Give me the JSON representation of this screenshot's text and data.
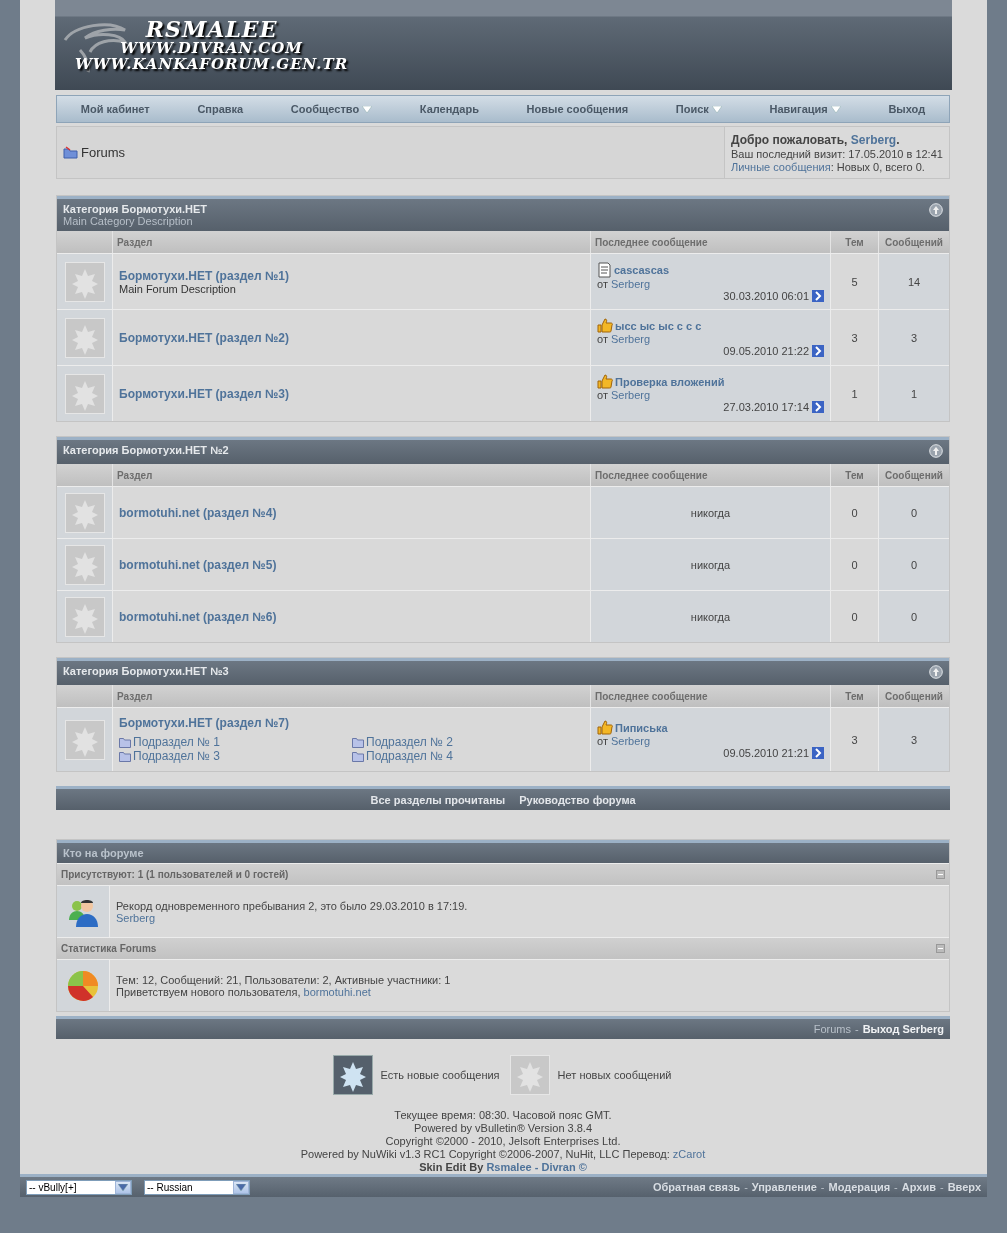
{
  "header": {
    "logo_lines": [
      "RSMALEE",
      "WWW.DIVRAN.COM",
      "WWW.KANKAFORUM.GEN.TR"
    ]
  },
  "navbar": [
    {
      "label": "Мой кабинет",
      "dropdown": false
    },
    {
      "label": "Справка",
      "dropdown": false
    },
    {
      "label": "Сообщество",
      "dropdown": true
    },
    {
      "label": "Календарь",
      "dropdown": false
    },
    {
      "label": "Новые сообщения",
      "dropdown": false
    },
    {
      "label": "Поиск",
      "dropdown": true
    },
    {
      "label": "Навигация",
      "dropdown": true
    },
    {
      "label": "Выход",
      "dropdown": false
    }
  ],
  "breadcrumb": {
    "title": "Forums"
  },
  "welcome": {
    "greeting": "Добро пожаловать, ",
    "user": "Serberg",
    "end": ".",
    "last_visit": "Ваш последний визит: 17.05.2010 в 12:41",
    "pm_link": "Личные сообщения",
    "pm_text": ": Новых 0, всего 0."
  },
  "categories": [
    {
      "title": "Категория Бормотухи.НЕТ",
      "description": "Main Category Description",
      "columns": [
        "Раздел",
        "Последнее сообщение",
        "Тем",
        "Сообщений"
      ],
      "forums": [
        {
          "title": "Бормотухи.НЕТ (раздел №1)",
          "description": "Main Forum Description",
          "new_posts": false,
          "last_post": {
            "kind": "document",
            "title": "cascascas",
            "by": "от",
            "user": "Serberg",
            "date": "30.03.2010 06:01"
          },
          "threads": "5",
          "posts": "14"
        },
        {
          "title": "Бормотухи.НЕТ (раздел №2)",
          "new_posts": false,
          "last_post": {
            "kind": "thumb",
            "title": "ысс ыс ыс с с с",
            "by": "от",
            "user": "Serberg",
            "date": "09.05.2010 21:22"
          },
          "threads": "3",
          "posts": "3"
        },
        {
          "title": "Бормотухи.НЕТ (раздел №3)",
          "new_posts": false,
          "last_post": {
            "kind": "thumb",
            "title": "Проверка вложений",
            "by": "от",
            "user": "Serberg",
            "date": "27.03.2010 17:14"
          },
          "threads": "1",
          "posts": "1"
        }
      ]
    },
    {
      "title": "Категория Бормотухи.НЕТ №2",
      "columns": [
        "Раздел",
        "Последнее сообщение",
        "Тем",
        "Сообщений"
      ],
      "forums": [
        {
          "title": "bormotuhi.net (раздел №4)",
          "new_posts": false,
          "last_post": {
            "kind": "never",
            "text": "никогда"
          },
          "threads": "0",
          "posts": "0"
        },
        {
          "title": "bormotuhi.net (раздел №5)",
          "new_posts": false,
          "last_post": {
            "kind": "never",
            "text": "никогда"
          },
          "threads": "0",
          "posts": "0"
        },
        {
          "title": "bormotuhi.net (раздел №6)",
          "new_posts": false,
          "last_post": {
            "kind": "never",
            "text": "никогда"
          },
          "threads": "0",
          "posts": "0"
        }
      ]
    },
    {
      "title": "Категория Бормотухи.НЕТ №3",
      "columns": [
        "Раздел",
        "Последнее сообщение",
        "Тем",
        "Сообщений"
      ],
      "forums": [
        {
          "title": "Бормотухи.НЕТ (раздел №7)",
          "new_posts": false,
          "subforums": [
            "Подраздел № 1",
            "Подраздел № 2",
            "Подраздел № 3",
            "Подраздел № 4"
          ],
          "last_post": {
            "kind": "thumb",
            "title": "Пиписька",
            "by": "от",
            "user": "Serberg",
            "date": "09.05.2010 21:21"
          },
          "threads": "3",
          "posts": "3"
        }
      ]
    }
  ],
  "forum_links": [
    "Все разделы прочитаны",
    "Руководство форума"
  ],
  "whos_online": {
    "title": "Кто на форуме",
    "sections": [
      {
        "kind": "users",
        "heading": "Присутствуют: 1 (1 пользователей и 0 гостей)",
        "lines": [
          {
            "text": "Рекорд одновременного пребывания 2, это было 29.03.2010 в 17:19."
          },
          {
            "link": "Serberg"
          }
        ]
      },
      {
        "kind": "stats",
        "heading": "Статистика Forums",
        "lines": [
          {
            "text": "Тем: 12, Сообщений: 21, Пользователи: 2, Активные участники: 1"
          },
          {
            "text": "Приветствуем нового пользователя, ",
            "link": "bormotuhi.net"
          }
        ]
      }
    ]
  },
  "footer_nav": {
    "links": [
      "Forums",
      "Выход Serberg"
    ],
    "separators": [
      "-"
    ]
  },
  "legend": [
    {
      "new_posts": true,
      "label": "Есть новые сообщения"
    },
    {
      "new_posts": false,
      "label": "Нет новых сообщений"
    }
  ],
  "copyright": {
    "lines": [
      "Текущее время: 08:30. Часовой пояс GMT.",
      "Powered by vBulletin® Version 3.8.4",
      "Copyright ©2000 - 2010, Jelsoft Enterprises Ltd."
    ],
    "nuwiki": "Powered by NuWiki v1.3 RC1 Copyright ©2006-2007, NuHit, LLC Перевод: ",
    "nuwiki_link": "zCarot",
    "skin": "Skin Edit By ",
    "skin_link": "Rsmalee - Divran ©"
  },
  "bottom_bar": {
    "selects": [
      "-- vBully[+]",
      "-- Russian"
    ],
    "links": [
      "Обратная связь",
      "Управление",
      "Модерация",
      "Архив",
      "Вверх"
    ],
    "separators": [
      "-",
      "-",
      "-",
      "-"
    ]
  }
}
